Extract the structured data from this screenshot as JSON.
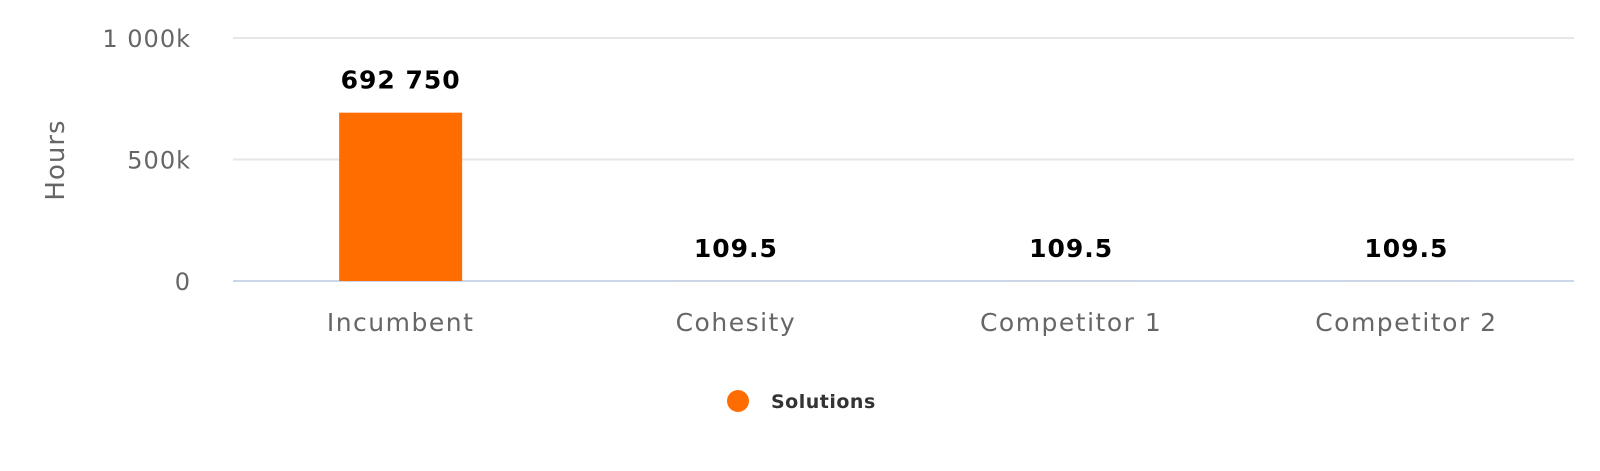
{
  "colors": {
    "series": "#ff6d00",
    "gridline": "#e6e6e6",
    "baseline": "#ccd6eb",
    "text": "#666666"
  },
  "chart_data": {
    "type": "bar",
    "categories": [
      "Incumbent",
      "Cohesity",
      "Competitor 1",
      "Competitor 2"
    ],
    "series": [
      {
        "name": "Solutions",
        "values": [
          692750,
          109.5,
          109.5,
          109.5
        ]
      }
    ],
    "data_labels": [
      "692 750",
      "109.5",
      "109.5",
      "109.5"
    ],
    "ylabel": "Hours",
    "xlabel": "",
    "ylim": [
      0,
      1000000
    ],
    "yticks": [
      {
        "value": 0,
        "label": "0"
      },
      {
        "value": 500000,
        "label": "500k"
      },
      {
        "value": 1000000,
        "label": "1 000k"
      }
    ],
    "grid": true,
    "legend": "bottom-center"
  }
}
